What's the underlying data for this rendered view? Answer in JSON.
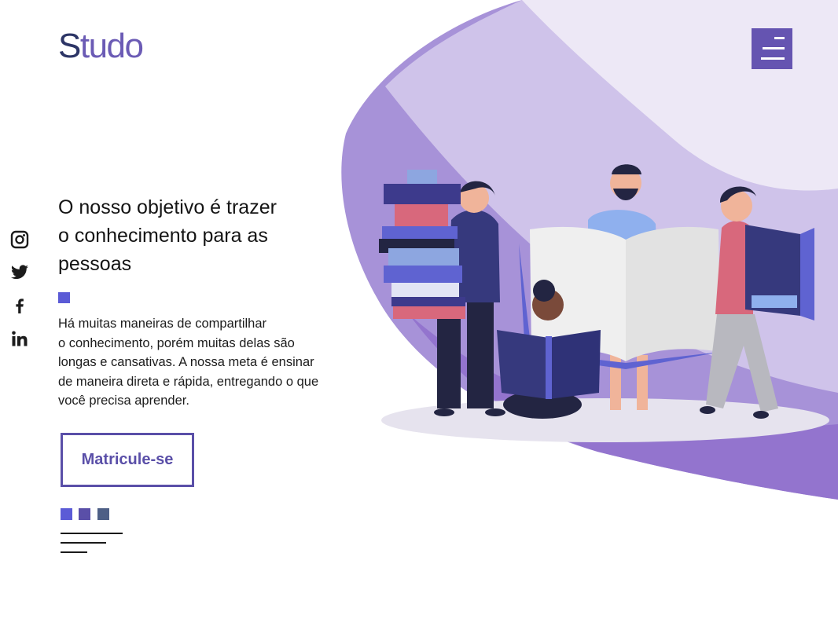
{
  "brand": {
    "logo_first": "S",
    "logo_rest": "tudo"
  },
  "header": {
    "menu_icon": "hamburger-menu-icon"
  },
  "social": [
    {
      "name": "instagram",
      "icon": "instagram-icon"
    },
    {
      "name": "twitter",
      "icon": "twitter-icon"
    },
    {
      "name": "facebook",
      "icon": "facebook-icon"
    },
    {
      "name": "linkedin",
      "icon": "linkedin-icon"
    }
  ],
  "hero": {
    "headline_lines": [
      "O nosso objetivo é trazer",
      "o conhecimento para as",
      "pessoas"
    ],
    "description_lines": [
      "Há muitas maneiras de compartilhar",
      "o conhecimento, porém muitas delas são",
      "longas e cansativas. A nossa meta é ensinar",
      "de maneira direta e rápida, entregando o que",
      "você precisa aprender."
    ],
    "cta_label": "Matricule-se",
    "illustration": "people-reading-books-illustration"
  },
  "carousel": {
    "dots": 3,
    "active_index": 0
  },
  "colors": {
    "brand_dark": "#2c3566",
    "brand_purple": "#6554b1",
    "accent_blue": "#5b5bd6",
    "cta_border": "#5a4fa8",
    "dot_colors": [
      "#5b5bd6",
      "#5a4fa8",
      "#4e5f86"
    ]
  }
}
